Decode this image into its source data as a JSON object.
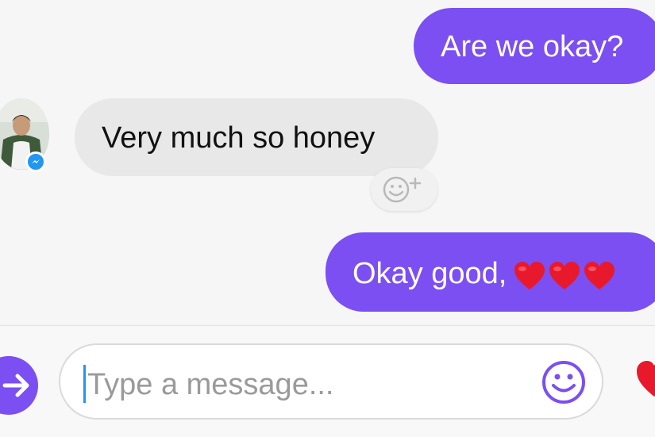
{
  "messages": [
    {
      "direction": "outgoing",
      "text": "Are we okay?"
    },
    {
      "direction": "incoming",
      "text": "Very much so honey"
    },
    {
      "direction": "outgoing",
      "text": "Okay good,",
      "emoji": [
        "red-heart",
        "red-heart",
        "red-heart"
      ]
    }
  ],
  "composer": {
    "placeholder": "Type a message..."
  },
  "colors": {
    "outgoing_bubble": "#7b4ff2",
    "incoming_bubble": "#e8e8e8",
    "accent": "#7b4ff2",
    "messenger_badge": "#2196f3",
    "heart": "#e8192c"
  },
  "icons": [
    "arrow-right-icon",
    "smiley-icon",
    "add-reaction-icon",
    "heart-icon",
    "messenger-icon"
  ]
}
